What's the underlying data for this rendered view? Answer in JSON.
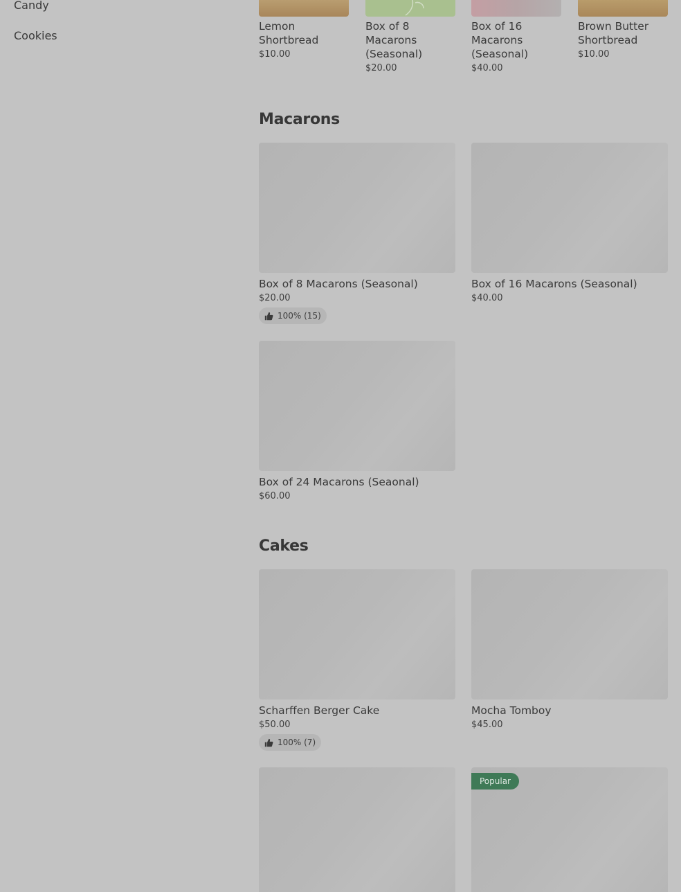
{
  "sidebar": {
    "items": [
      {
        "label": "Candy"
      },
      {
        "label": "Cookies"
      }
    ]
  },
  "top_row": [
    {
      "name": "Lemon Shortbread",
      "price": "$10.00",
      "img_color": "#b79a6c"
    },
    {
      "name": "Box of 8 Macarons (Seasonal)",
      "price": "$20.00",
      "img_color": "#a9c08f"
    },
    {
      "name": "Box of 16 Macarons (Seasonal)",
      "price": "$40.00",
      "img_color": "#b8a2a4"
    },
    {
      "name": "Brown Butter Shortbread",
      "price": "$10.00",
      "img_color": "#bb9b6a"
    }
  ],
  "sections": {
    "macarons": {
      "title": "Macarons",
      "items": [
        {
          "name": "Box of 8 Macarons (Seasonal)",
          "price": "$20.00",
          "rating": "100% (15)"
        },
        {
          "name": "Box of 16 Macarons (Seasonal)",
          "price": "$40.00"
        },
        {
          "name": "Box of 24 Macarons (Seaonal)",
          "price": "$60.00"
        }
      ]
    },
    "cakes": {
      "title": "Cakes",
      "items": [
        {
          "name": "Scharffen Berger Cake",
          "price": "$50.00",
          "rating": "100% (7)"
        },
        {
          "name": "Mocha Tomboy",
          "price": "$45.00"
        },
        {
          "name": ""
        },
        {
          "badge": "Popular"
        }
      ]
    }
  }
}
